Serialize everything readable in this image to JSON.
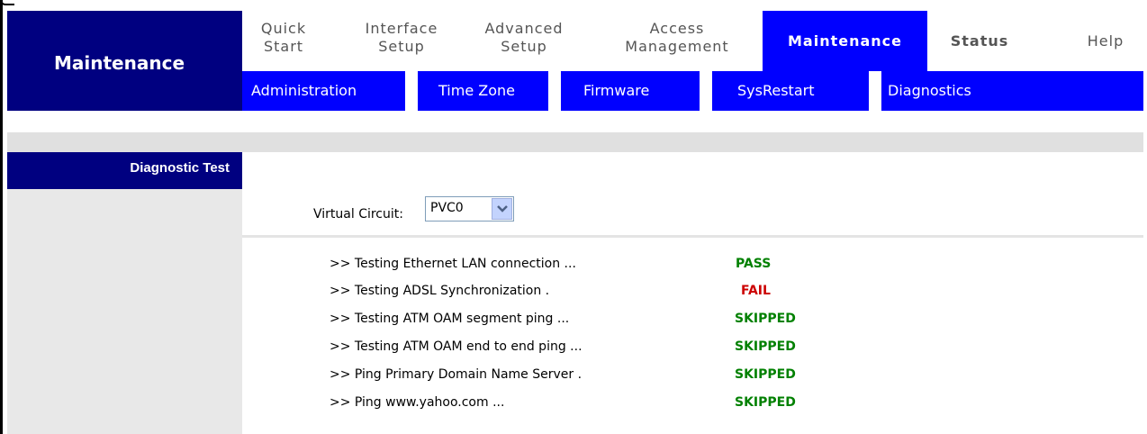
{
  "brand": {
    "title": "Maintenance"
  },
  "tabs": [
    {
      "label_line1": "Quick",
      "label_line2": "Start"
    },
    {
      "label_line1": "Interface",
      "label_line2": "Setup"
    },
    {
      "label_line1": "Advanced",
      "label_line2": "Setup"
    },
    {
      "label_line1": "Access",
      "label_line2": "Management"
    },
    {
      "label_line1": "Maintenance",
      "label_line2": ""
    },
    {
      "label_line1": "Status",
      "label_line2": ""
    },
    {
      "label_line1": "Help",
      "label_line2": ""
    }
  ],
  "subnav": [
    "Administration",
    "Time Zone",
    "Firmware",
    "SysRestart",
    "Diagnostics"
  ],
  "side": {
    "heading": "Diagnostic Test"
  },
  "virtual_circuit": {
    "label": "Virtual Circuit:",
    "selected": "PVC0"
  },
  "tests": [
    {
      "text": ">> Testing Ethernet LAN connection ...",
      "result": "PASS",
      "color": "#008000"
    },
    {
      "text": ">> Testing ADSL Synchronization .",
      "result": "FAIL",
      "color": "#cc0000"
    },
    {
      "text": ">> Testing ATM OAM segment ping ...",
      "result": "SKIPPED",
      "color": "#008000"
    },
    {
      "text": ">> Testing ATM OAM end to end ping ...",
      "result": "SKIPPED",
      "color": "#008000"
    },
    {
      "text": ">> Ping Primary Domain Name Server .",
      "result": "SKIPPED",
      "color": "#008000"
    },
    {
      "text": ">> Ping www.yahoo.com ...",
      "result": "SKIPPED",
      "color": "#008000"
    }
  ]
}
